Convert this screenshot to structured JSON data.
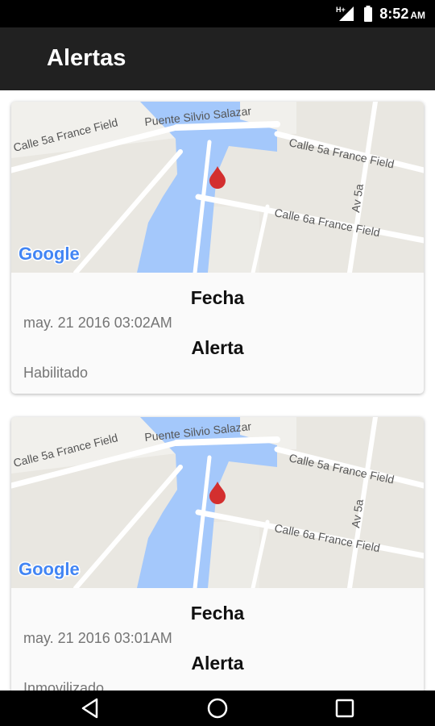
{
  "status_bar": {
    "time": "8:52",
    "ampm": "AM",
    "network": "H+",
    "icons": [
      "signal-icon",
      "battery-icon"
    ]
  },
  "app_bar": {
    "title": "Alertas"
  },
  "map": {
    "attribution": "Google",
    "streets": [
      "Puente Silvio Salazar",
      "Calle 5a France Field",
      "Calle 6a France Field",
      "Av 5a"
    ],
    "marker_color": "#d32f2f",
    "water_color": "#a4c8fb",
    "land_color": "#e9e7e1"
  },
  "alerts": [
    {
      "fecha_label": "Fecha",
      "fecha_value": "may. 21 2016 03:02AM",
      "alerta_label": "Alerta",
      "alerta_value": "Habilitado"
    },
    {
      "fecha_label": "Fecha",
      "fecha_value": "may. 21 2016 03:01AM",
      "alerta_label": "Alerta",
      "alerta_value": "Inmovilizado"
    }
  ],
  "nav_bar": {
    "buttons": [
      "back-icon",
      "home-icon",
      "recents-icon"
    ]
  }
}
